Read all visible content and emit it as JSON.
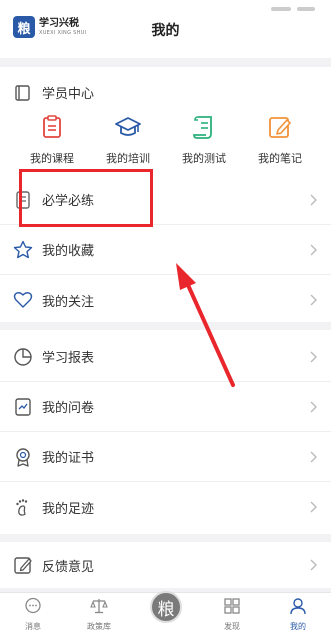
{
  "header": {
    "logo_mark": "粮",
    "logo_cn": "学习兴税",
    "logo_en": "XUEXI XING SHUI",
    "title": "我的"
  },
  "student_center": {
    "title": "学员中心",
    "shortcuts": [
      {
        "label": "我的课程",
        "icon": "clipboard-icon",
        "color": "#e4473f"
      },
      {
        "label": "我的培训",
        "icon": "graduation-cap-icon",
        "color": "#2a5aa7"
      },
      {
        "label": "我的测试",
        "icon": "scroll-icon",
        "color": "#2bb07c"
      },
      {
        "label": "我的笔记",
        "icon": "edit-note-icon",
        "color": "#f2923a"
      }
    ]
  },
  "list1": [
    {
      "label": "必学必练",
      "icon": "book-icon"
    },
    {
      "label": "我的收藏",
      "icon": "star-icon"
    },
    {
      "label": "我的关注",
      "icon": "heart-icon"
    }
  ],
  "list2": [
    {
      "label": "学习报表",
      "icon": "pie-chart-icon"
    },
    {
      "label": "我的问卷",
      "icon": "survey-icon"
    },
    {
      "label": "我的证书",
      "icon": "certificate-icon"
    },
    {
      "label": "我的足迹",
      "icon": "footprint-icon"
    }
  ],
  "list3": [
    {
      "label": "反馈意见",
      "icon": "feedback-icon"
    }
  ],
  "tabbar": {
    "tabs": [
      {
        "label": "消息",
        "icon": "message-icon"
      },
      {
        "label": "政策库",
        "icon": "scales-icon"
      },
      {
        "label": "",
        "icon": "logo-center-icon"
      },
      {
        "label": "发现",
        "icon": "grid-icon"
      },
      {
        "label": "我的",
        "icon": "person-icon"
      }
    ],
    "center_mark": "粮",
    "active": "我的"
  },
  "colors": {
    "accent": "#2a5aa7",
    "annotation": "#e8262b",
    "background": "#f2f2f4"
  }
}
